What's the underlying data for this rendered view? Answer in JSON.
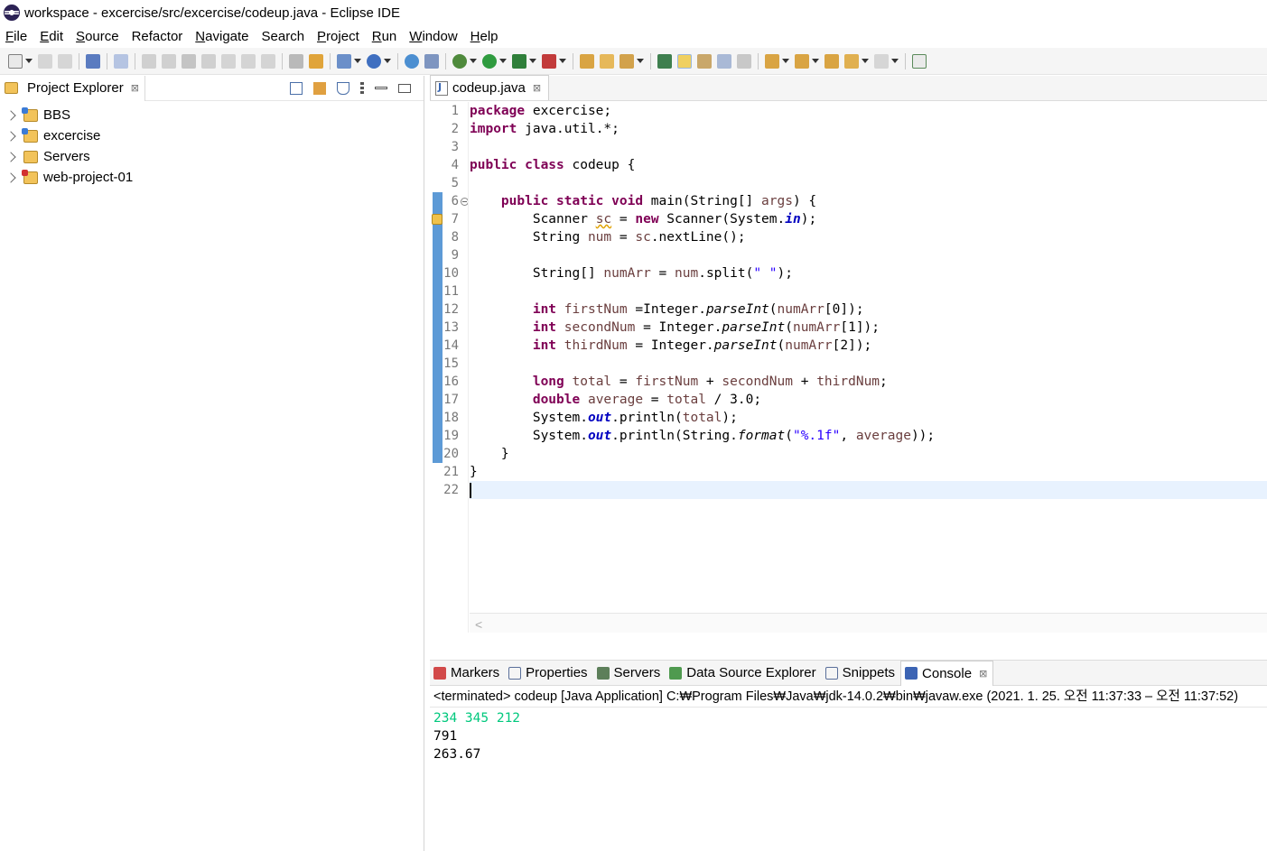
{
  "window": {
    "title": "workspace - excercise/src/excercise/codeup.java - Eclipse IDE"
  },
  "menu": [
    {
      "label": "File",
      "mnemonic": "F",
      "rest": "ile"
    },
    {
      "label": "Edit",
      "mnemonic": "E",
      "rest": "dit"
    },
    {
      "label": "Source",
      "mnemonic": "S",
      "rest": "ource"
    },
    {
      "label": "Refactor",
      "mnemonic": "",
      "rest": "Refactor"
    },
    {
      "label": "Navigate",
      "mnemonic": "N",
      "rest": "avigate"
    },
    {
      "label": "Search",
      "mnemonic": "",
      "rest": "Search"
    },
    {
      "label": "Project",
      "mnemonic": "P",
      "rest": "roject"
    },
    {
      "label": "Run",
      "mnemonic": "R",
      "rest": "un"
    },
    {
      "label": "Window",
      "mnemonic": "W",
      "rest": "indow"
    },
    {
      "label": "Help",
      "mnemonic": "H",
      "rest": "elp"
    }
  ],
  "explorer": {
    "title": "Project Explorer",
    "close_glyph": "⊠",
    "items": [
      {
        "label": "BBS"
      },
      {
        "label": "excercise"
      },
      {
        "label": "Servers"
      },
      {
        "label": "web-project-01"
      }
    ]
  },
  "editor": {
    "tab_label": "codeup.java",
    "close_glyph": "⊠",
    "line_numbers": [
      "1",
      "2",
      "3",
      "4",
      "5",
      "6",
      "7",
      "8",
      "9",
      "10",
      "11",
      "12",
      "13",
      "14",
      "15",
      "16",
      "17",
      "18",
      "19",
      "20",
      "21",
      "22"
    ],
    "lines": [
      "package excercise;",
      "import java.util.*;",
      "",
      "public class codeup {",
      "",
      "    public static void main(String[] args) {",
      "        Scanner sc = new Scanner(System.in);",
      "        String num = sc.nextLine();",
      "",
      "        String[] numArr = num.split(\" \");",
      "",
      "        int firstNum =Integer.parseInt(numArr[0]);",
      "        int secondNum = Integer.parseInt(numArr[1]);",
      "        int thirdNum = Integer.parseInt(numArr[2]);",
      "",
      "        long total = firstNum + secondNum + thirdNum;",
      "        double average = total / 3.0;",
      "        System.out.println(total);",
      "        System.out.println(String.format(\"%.1f\", average));",
      "    }",
      "}",
      ""
    ],
    "scroll_arrow": "<"
  },
  "console": {
    "tabs": [
      {
        "label": "Markers"
      },
      {
        "label": "Properties"
      },
      {
        "label": "Servers"
      },
      {
        "label": "Data Source Explorer"
      },
      {
        "label": "Snippets"
      },
      {
        "label": "Console"
      }
    ],
    "close_glyph": "⊠",
    "status": "<terminated> codeup [Java Application] C:₩Program Files₩Java₩jdk-14.0.2₩bin₩javaw.exe  (2021. 1. 25. 오전 11:37:33 – 오전 11:37:52)",
    "output": [
      {
        "text": "234 345 212",
        "kind": "input"
      },
      {
        "text": "791",
        "kind": "output"
      },
      {
        "text": "263.67",
        "kind": "output"
      }
    ]
  },
  "colors": {
    "keyword": "#7f0055",
    "local_var": "#6a3e3e",
    "string": "#2a00ff",
    "static_field": "#0000c0",
    "console_input": "#00c87d",
    "change_bar": "#5d9ad6"
  }
}
